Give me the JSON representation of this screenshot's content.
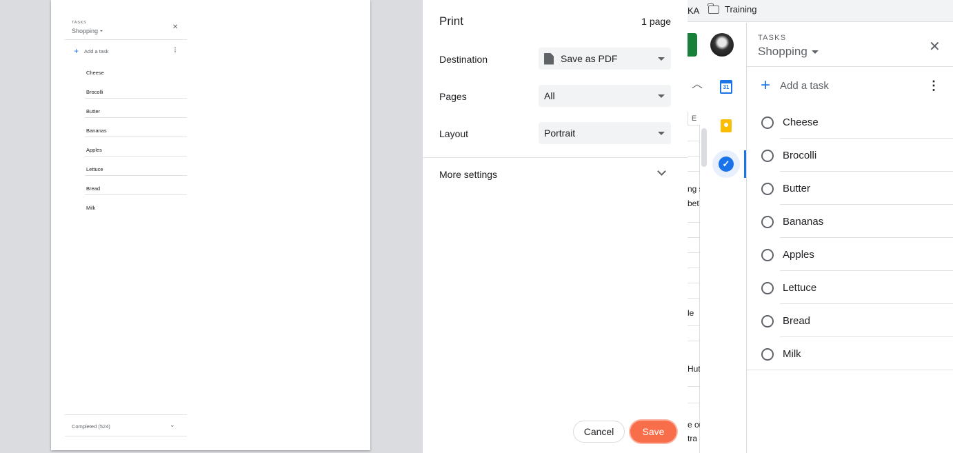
{
  "bookmarks": {
    "partial": "KA",
    "folder": "Training"
  },
  "sheet_fragments": [
    "ng s",
    "bet",
    "le",
    "Hut",
    "e ou",
    "tra"
  ],
  "column_header": "E",
  "calendar_day": "31",
  "tasks_panel": {
    "section_label": "TASKS",
    "list_name": "Shopping",
    "add_task_label": "Add a task",
    "items": [
      "Cheese",
      "Brocolli",
      "Butter",
      "Bananas",
      "Apples",
      "Lettuce",
      "Bread",
      "Milk"
    ]
  },
  "preview": {
    "section_label": "TASKS",
    "list_name": "Shopping",
    "add_task_label": "Add a task",
    "items": [
      "Cheese",
      "Brocolli",
      "Butter",
      "Bananas",
      "Apples",
      "Lettuce",
      "Bread",
      "Milk"
    ],
    "completed_label": "Completed (524)"
  },
  "print_dialog": {
    "title": "Print",
    "page_count": "1 page",
    "destination_label": "Destination",
    "destination_value": "Save as PDF",
    "pages_label": "Pages",
    "pages_value": "All",
    "layout_label": "Layout",
    "layout_value": "Portrait",
    "more_settings_label": "More settings",
    "cancel_label": "Cancel",
    "save_label": "Save"
  },
  "colors": {
    "accent": "#1a73e8",
    "save_button": "#f96e4a"
  }
}
